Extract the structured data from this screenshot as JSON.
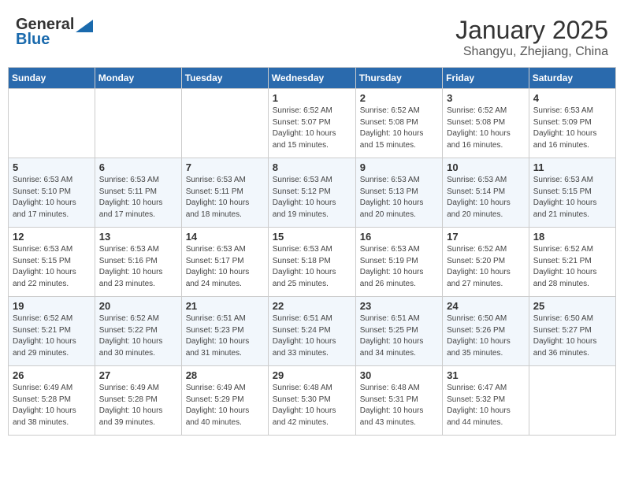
{
  "logo": {
    "general": "General",
    "blue": "Blue"
  },
  "title": "January 2025",
  "location": "Shangyu, Zhejiang, China",
  "days_of_week": [
    "Sunday",
    "Monday",
    "Tuesday",
    "Wednesday",
    "Thursday",
    "Friday",
    "Saturday"
  ],
  "weeks": [
    [
      {
        "day": "",
        "info": ""
      },
      {
        "day": "",
        "info": ""
      },
      {
        "day": "",
        "info": ""
      },
      {
        "day": "1",
        "info": "Sunrise: 6:52 AM\nSunset: 5:07 PM\nDaylight: 10 hours\nand 15 minutes."
      },
      {
        "day": "2",
        "info": "Sunrise: 6:52 AM\nSunset: 5:08 PM\nDaylight: 10 hours\nand 15 minutes."
      },
      {
        "day": "3",
        "info": "Sunrise: 6:52 AM\nSunset: 5:08 PM\nDaylight: 10 hours\nand 16 minutes."
      },
      {
        "day": "4",
        "info": "Sunrise: 6:53 AM\nSunset: 5:09 PM\nDaylight: 10 hours\nand 16 minutes."
      }
    ],
    [
      {
        "day": "5",
        "info": "Sunrise: 6:53 AM\nSunset: 5:10 PM\nDaylight: 10 hours\nand 17 minutes."
      },
      {
        "day": "6",
        "info": "Sunrise: 6:53 AM\nSunset: 5:11 PM\nDaylight: 10 hours\nand 17 minutes."
      },
      {
        "day": "7",
        "info": "Sunrise: 6:53 AM\nSunset: 5:11 PM\nDaylight: 10 hours\nand 18 minutes."
      },
      {
        "day": "8",
        "info": "Sunrise: 6:53 AM\nSunset: 5:12 PM\nDaylight: 10 hours\nand 19 minutes."
      },
      {
        "day": "9",
        "info": "Sunrise: 6:53 AM\nSunset: 5:13 PM\nDaylight: 10 hours\nand 20 minutes."
      },
      {
        "day": "10",
        "info": "Sunrise: 6:53 AM\nSunset: 5:14 PM\nDaylight: 10 hours\nand 20 minutes."
      },
      {
        "day": "11",
        "info": "Sunrise: 6:53 AM\nSunset: 5:15 PM\nDaylight: 10 hours\nand 21 minutes."
      }
    ],
    [
      {
        "day": "12",
        "info": "Sunrise: 6:53 AM\nSunset: 5:15 PM\nDaylight: 10 hours\nand 22 minutes."
      },
      {
        "day": "13",
        "info": "Sunrise: 6:53 AM\nSunset: 5:16 PM\nDaylight: 10 hours\nand 23 minutes."
      },
      {
        "day": "14",
        "info": "Sunrise: 6:53 AM\nSunset: 5:17 PM\nDaylight: 10 hours\nand 24 minutes."
      },
      {
        "day": "15",
        "info": "Sunrise: 6:53 AM\nSunset: 5:18 PM\nDaylight: 10 hours\nand 25 minutes."
      },
      {
        "day": "16",
        "info": "Sunrise: 6:53 AM\nSunset: 5:19 PM\nDaylight: 10 hours\nand 26 minutes."
      },
      {
        "day": "17",
        "info": "Sunrise: 6:52 AM\nSunset: 5:20 PM\nDaylight: 10 hours\nand 27 minutes."
      },
      {
        "day": "18",
        "info": "Sunrise: 6:52 AM\nSunset: 5:21 PM\nDaylight: 10 hours\nand 28 minutes."
      }
    ],
    [
      {
        "day": "19",
        "info": "Sunrise: 6:52 AM\nSunset: 5:21 PM\nDaylight: 10 hours\nand 29 minutes."
      },
      {
        "day": "20",
        "info": "Sunrise: 6:52 AM\nSunset: 5:22 PM\nDaylight: 10 hours\nand 30 minutes."
      },
      {
        "day": "21",
        "info": "Sunrise: 6:51 AM\nSunset: 5:23 PM\nDaylight: 10 hours\nand 31 minutes."
      },
      {
        "day": "22",
        "info": "Sunrise: 6:51 AM\nSunset: 5:24 PM\nDaylight: 10 hours\nand 33 minutes."
      },
      {
        "day": "23",
        "info": "Sunrise: 6:51 AM\nSunset: 5:25 PM\nDaylight: 10 hours\nand 34 minutes."
      },
      {
        "day": "24",
        "info": "Sunrise: 6:50 AM\nSunset: 5:26 PM\nDaylight: 10 hours\nand 35 minutes."
      },
      {
        "day": "25",
        "info": "Sunrise: 6:50 AM\nSunset: 5:27 PM\nDaylight: 10 hours\nand 36 minutes."
      }
    ],
    [
      {
        "day": "26",
        "info": "Sunrise: 6:49 AM\nSunset: 5:28 PM\nDaylight: 10 hours\nand 38 minutes."
      },
      {
        "day": "27",
        "info": "Sunrise: 6:49 AM\nSunset: 5:28 PM\nDaylight: 10 hours\nand 39 minutes."
      },
      {
        "day": "28",
        "info": "Sunrise: 6:49 AM\nSunset: 5:29 PM\nDaylight: 10 hours\nand 40 minutes."
      },
      {
        "day": "29",
        "info": "Sunrise: 6:48 AM\nSunset: 5:30 PM\nDaylight: 10 hours\nand 42 minutes."
      },
      {
        "day": "30",
        "info": "Sunrise: 6:48 AM\nSunset: 5:31 PM\nDaylight: 10 hours\nand 43 minutes."
      },
      {
        "day": "31",
        "info": "Sunrise: 6:47 AM\nSunset: 5:32 PM\nDaylight: 10 hours\nand 44 minutes."
      },
      {
        "day": "",
        "info": ""
      }
    ]
  ]
}
